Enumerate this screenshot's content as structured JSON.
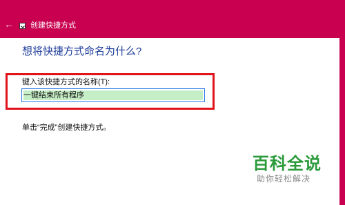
{
  "window": {
    "title": "创建快捷方式",
    "back_icon": "arrow-left-icon",
    "app_icon": "shortcut-icon"
  },
  "dialog": {
    "heading": "想将快捷方式命名为什么?",
    "name_label": "键入该快捷方式的名称(T):",
    "name_value": "一键结束所有程序",
    "instruction": "单击“完成”创建快捷方式。"
  },
  "watermark": {
    "logo": "百科全说",
    "tagline": "助你轻松解决"
  },
  "colors": {
    "title_bar": "#c8004f",
    "heading_text": "#1e3d9a",
    "highlight_border": "#e0121a",
    "selection": "#c6eec6",
    "watermark_green": "#2a9a3a"
  }
}
